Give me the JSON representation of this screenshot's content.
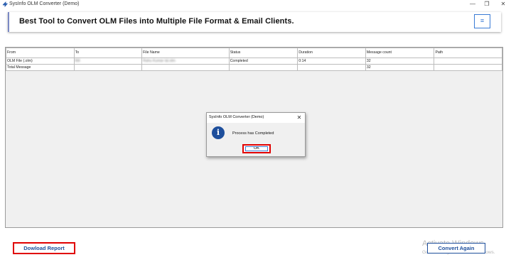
{
  "window": {
    "title": "SysInfo OLM Converter (Demo)",
    "minimize_glyph": "—",
    "maximize_glyph": "❐",
    "close_glyph": "✕"
  },
  "banner": {
    "headline": "Best Tool to Convert OLM Files into Multiple File Format & Email Clients.",
    "menu_icon": "hamburger-icon",
    "menu_glyph": "≡"
  },
  "table": {
    "columns": [
      "From",
      "To",
      "File Name",
      "Status",
      "Duration",
      "Message count",
      "Path"
    ],
    "rows": [
      {
        "from": "OLM File (.olm)",
        "to": "Bill",
        "file_name": "Rahu Kumar lal.olm",
        "status": "Completed",
        "duration": "0:14",
        "message_count": "32",
        "path": ""
      },
      {
        "from": "Total Message",
        "to": "",
        "file_name": "",
        "status": "",
        "duration": "",
        "message_count": "32",
        "path": ""
      }
    ]
  },
  "dialog": {
    "title": "SysInfo OLM Converter (Demo)",
    "close_glyph": "✕",
    "icon": "info-icon",
    "icon_glyph": "i",
    "message": "Process has Completed",
    "ok_label": "OK"
  },
  "footer": {
    "report_label": "Dowload Report",
    "convert_label": "Convert Again"
  },
  "watermark": {
    "line1": "Activate Windows",
    "line2": "Go to Settings to activate Windows."
  },
  "colors": {
    "accent_blue": "#1e4f9c",
    "highlight_red": "#e00000",
    "grid_background": "#f0f0f0"
  }
}
